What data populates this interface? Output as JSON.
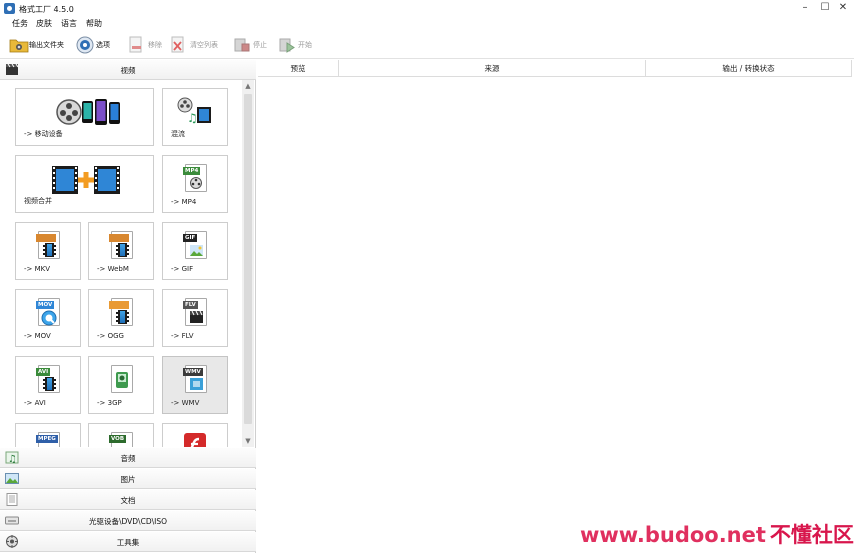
{
  "window": {
    "title": "格式工厂 4.5.0",
    "minimize": "–",
    "maximize": "☐",
    "close": "✕"
  },
  "menu": [
    "任务",
    "皮肤",
    "语言",
    "帮助"
  ],
  "toolbar": {
    "output_folder": "输出文件夹",
    "options": "选项",
    "remove": "移除",
    "clear_list": "清空列表",
    "stop": "停止",
    "start": "开始"
  },
  "left": {
    "video_header": "视频",
    "tiles": [
      {
        "label": "-> 移动设备",
        "icon": "mobile-devices-icon"
      },
      {
        "label": "混流",
        "icon": "mux-icon"
      },
      {
        "label": "视频合并",
        "icon": "video-merge-icon"
      },
      {
        "label": "-> MP4",
        "icon": "mp4-file-icon",
        "tag": "MP4"
      },
      {
        "label": "-> MKV",
        "icon": "mkv-file-icon"
      },
      {
        "label": "-> WebM",
        "icon": "webm-file-icon"
      },
      {
        "label": "-> GIF",
        "icon": "gif-file-icon",
        "tag": "GIF"
      },
      {
        "label": "-> MOV",
        "icon": "mov-file-icon",
        "tag": "MOV"
      },
      {
        "label": "-> OGG",
        "icon": "ogg-file-icon"
      },
      {
        "label": "-> FLV",
        "icon": "flv-file-icon",
        "tag": "FLV"
      },
      {
        "label": "-> AVI",
        "icon": "avi-file-icon",
        "tag": "AVI"
      },
      {
        "label": "-> 3GP",
        "icon": "3gp-file-icon",
        "tag": "3GP"
      },
      {
        "label": "-> WMV",
        "icon": "wmv-file-icon",
        "tag": "WMV"
      },
      {
        "label": "",
        "icon": "mpeg-file-icon",
        "tag": "MPEG"
      },
      {
        "label": "",
        "icon": "vob-file-icon",
        "tag": "VOB"
      },
      {
        "label": "",
        "icon": "swf-file-icon"
      }
    ],
    "categories": [
      "音频",
      "图片",
      "文档",
      "光驱设备\\DVD\\CD\\ISO",
      "工具集"
    ]
  },
  "right": {
    "columns": [
      "预览",
      "来源",
      "输出 / 转换状态"
    ]
  },
  "watermark": {
    "site": "www.budoo.net",
    "name": "不懂社区"
  },
  "colors": {
    "accent": "#2f6fb5",
    "watermark": "#e0305f",
    "selected_tile": "#e8e8e8"
  }
}
